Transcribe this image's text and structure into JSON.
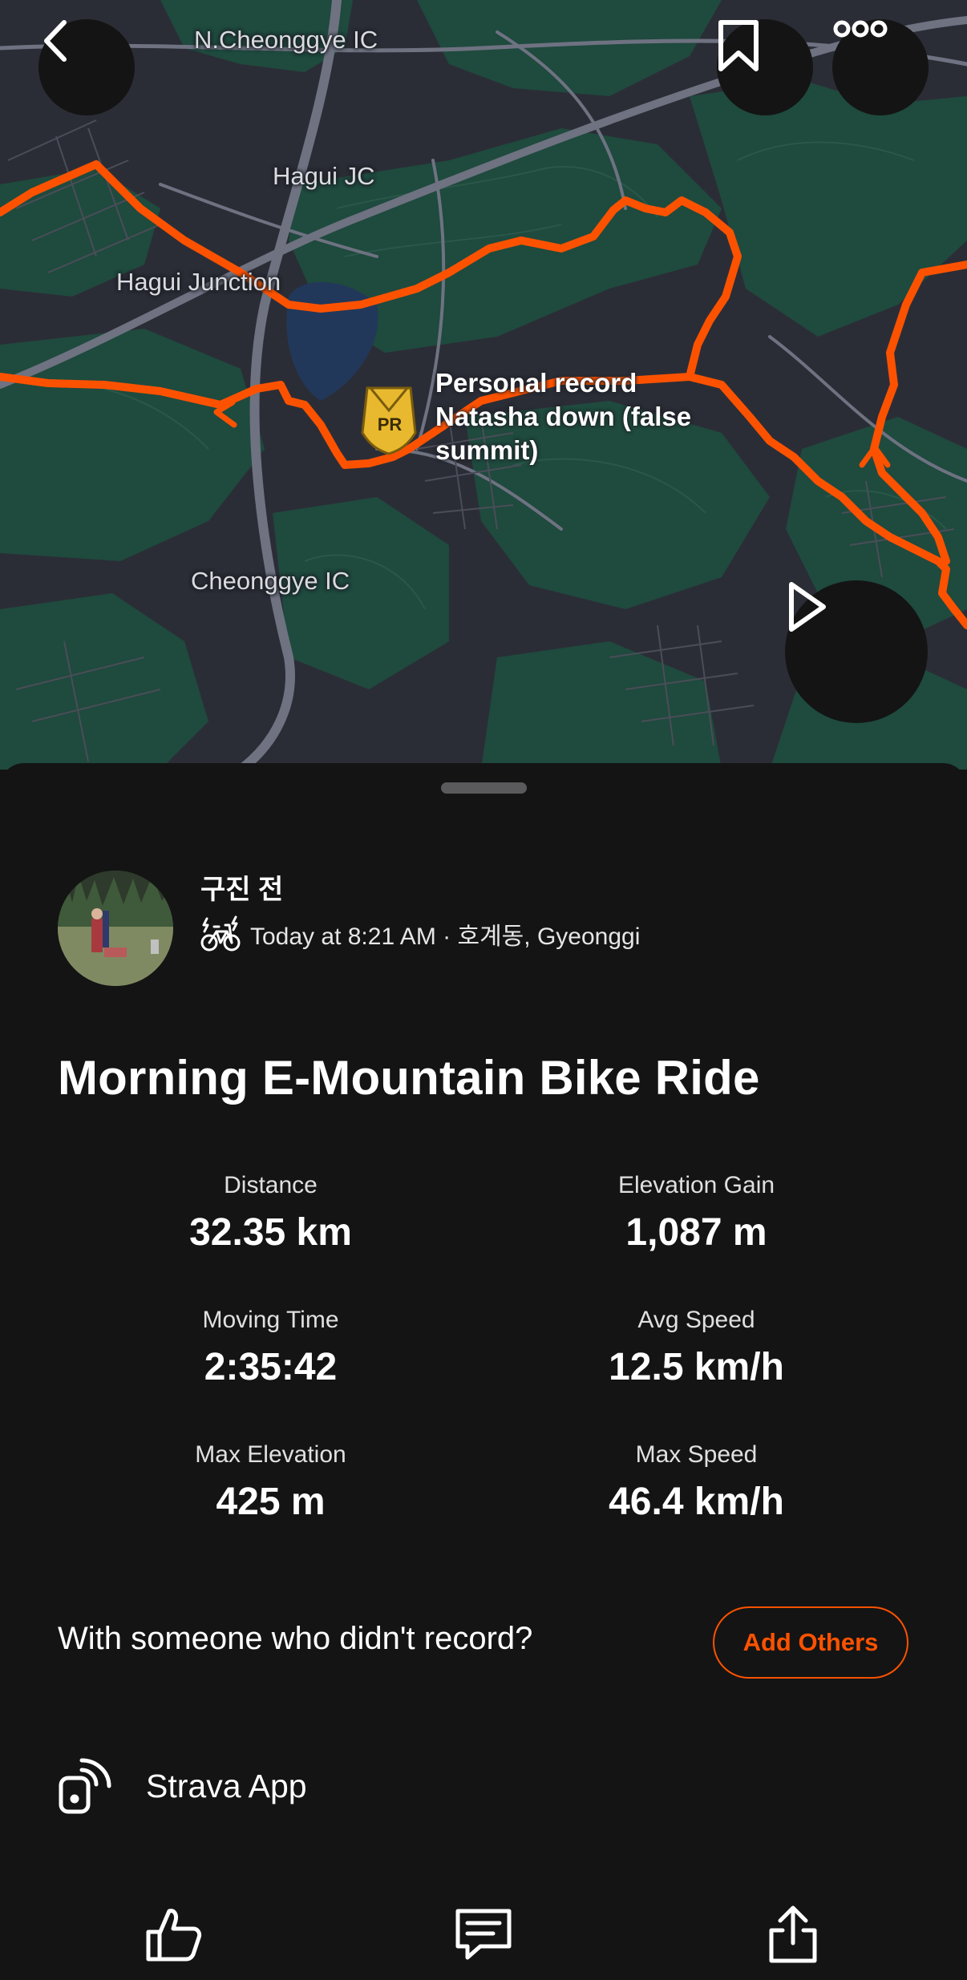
{
  "map": {
    "labels": {
      "n_cheonggye_ic": "N.Cheonggye IC",
      "hagui_jc": "Hagui JC",
      "hagui_junction": "Hagui Junction",
      "cheonggye_ic": "Cheonggye IC"
    },
    "pr_badge_text": "PR",
    "pr_annotation": {
      "line1": "Personal record",
      "line2": "Natasha down (false",
      "line3": "summit)"
    },
    "colors": {
      "route": "#fc5200",
      "forest": "#1f4a3e",
      "land": "#2b2d36",
      "water": "#22385a",
      "pr_badge": "#e8b92e"
    }
  },
  "top_buttons": {
    "back": "back-icon",
    "bookmark": "bookmark-icon",
    "more": "more-icon",
    "play": "play-icon"
  },
  "athlete": {
    "name": "구진 전",
    "activity_icon": "e-mountain-bike-icon",
    "meta": "Today at 8:21 AM · 호계동, Gyeonggi"
  },
  "activity": {
    "title": "Morning E-Mountain Bike Ride",
    "stats": [
      {
        "label": "Distance",
        "value": "32.35 km"
      },
      {
        "label": "Elevation Gain",
        "value": "1,087 m"
      },
      {
        "label": "Moving Time",
        "value": "2:35:42"
      },
      {
        "label": "Avg Speed",
        "value": "12.5 km/h"
      },
      {
        "label": "Max Elevation",
        "value": "425 m"
      },
      {
        "label": "Max Speed",
        "value": "46.4 km/h"
      }
    ]
  },
  "group": {
    "prompt": "With someone who didn't record?",
    "button_label": "Add Others"
  },
  "device": {
    "icon": "device-wireless-icon",
    "name": "Strava App"
  },
  "actions": {
    "kudos": "thumbs-up-icon",
    "comment": "comment-icon",
    "share": "share-icon"
  },
  "theme": {
    "accent": "#fc5200",
    "background": "#141414"
  }
}
